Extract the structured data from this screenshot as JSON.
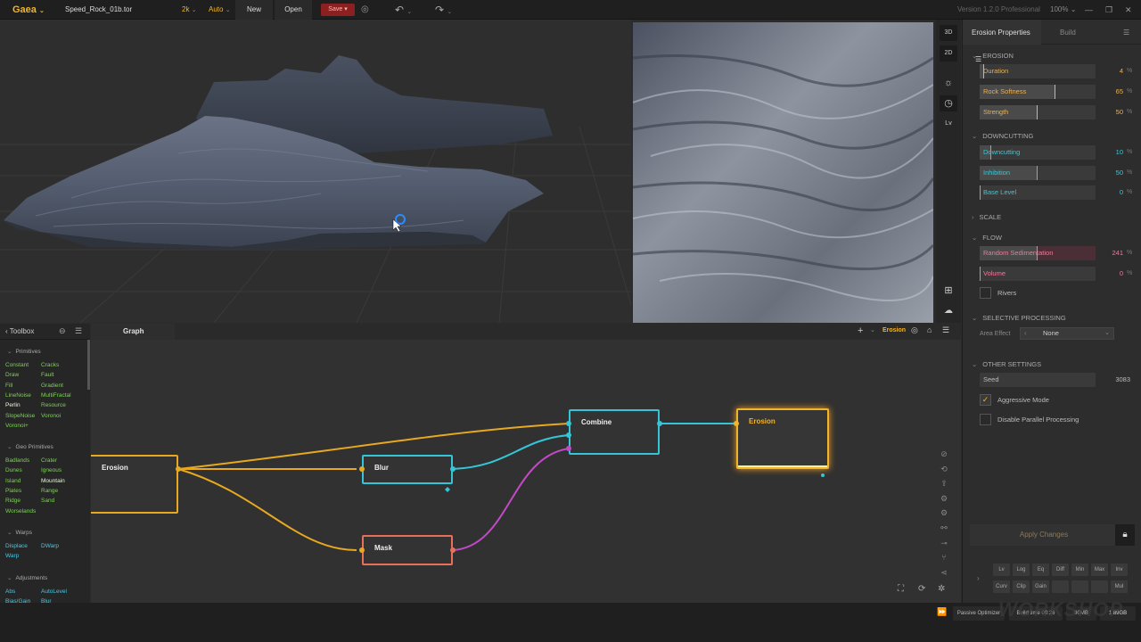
{
  "topbar": {
    "app_name": "Gaea",
    "file_name": "Speed_Rock_01b.tor",
    "resolution": "2k",
    "mode": "Auto",
    "new_label": "New",
    "open_label": "Open",
    "save_label": "Save",
    "version": "Version 1.2.0 Professional",
    "zoom": "100%"
  },
  "view_tools": {
    "btn_3d": "3D",
    "btn_2d": "2D",
    "btn_lv": "Lv"
  },
  "properties": {
    "tab_active": "Erosion Properties",
    "tab_build": "Build",
    "sections": {
      "erosion": "EROSION",
      "downcutting": "DOWNCUTTING",
      "scale": "SCALE",
      "flow": "FLOW",
      "selective": "SELECTIVE PROCESSING",
      "other": "OTHER SETTINGS"
    },
    "params": [
      {
        "label": "Duration",
        "value": "4",
        "unit": "%",
        "fill": 0.04,
        "color": "#e8b25a"
      },
      {
        "label": "Rock Softness",
        "value": "65",
        "unit": "%",
        "fill": 0.65,
        "color": "#e8b25a"
      },
      {
        "label": "Strength",
        "value": "50",
        "unit": "%",
        "fill": 0.5,
        "color": "#e8b25a"
      },
      {
        "label": "Downcutting",
        "value": "10",
        "unit": "%",
        "fill": 0.1,
        "color": "#3cc8d8"
      },
      {
        "label": "Inhibition",
        "value": "50",
        "unit": "%",
        "fill": 0.5,
        "color": "#3cc8d8"
      },
      {
        "label": "Base Level",
        "value": "0",
        "unit": "%",
        "fill": 0.0,
        "color": "#3cc8d8"
      },
      {
        "label": "Random Sedimentation",
        "value": "241",
        "unit": "%",
        "fill": 0.5,
        "color": "#f07a9a"
      },
      {
        "label": "Volume",
        "value": "0",
        "unit": "%",
        "fill": 0.0,
        "color": "#f07a9a"
      }
    ],
    "rivers_label": "Rivers",
    "area_effect_label": "Area Effect",
    "area_effect_value": "None",
    "seed_label": "Seed",
    "seed_value": "3083",
    "aggressive_label": "Aggressive Mode",
    "aggressive_checked": true,
    "parallel_label": "Disable Parallel Processing",
    "parallel_checked": false,
    "apply_label": "Apply Changes",
    "quick_row1": [
      "Lv",
      "Log",
      "Eq",
      "Diff",
      "Min",
      "Max",
      "Inv"
    ],
    "quick_row2": [
      "Curv",
      "Clip",
      "Gain",
      "",
      "",
      "",
      "Mul"
    ]
  },
  "toolbox": {
    "title": "Toolbox",
    "categories": [
      {
        "name": "Primitives",
        "items": [
          "Constant",
          "Cracks",
          "Draw",
          "Fault",
          "Fill",
          "Gradient",
          "LineNoise",
          "MultiFractal",
          "Perlin",
          "Resource",
          "SlopeNoise",
          "Voronoi",
          "Voronoi+"
        ]
      },
      {
        "name": "Geo Primitives",
        "items": [
          "Badlands",
          "Crater",
          "Dunes",
          "Igneous",
          "Island",
          "Mountain",
          "Plates",
          "Range",
          "Ridge",
          "Sand",
          "Worselands"
        ]
      },
      {
        "name": "Warps",
        "items": [
          "Displace",
          "DWarp",
          "Warp"
        ]
      },
      {
        "name": "Adjustments",
        "items": [
          "Abs",
          "AutoLevel",
          "Bias/Gain",
          "Blur"
        ]
      }
    ]
  },
  "graph": {
    "tab_label": "Graph",
    "active_node": "Erosion",
    "nodes": [
      {
        "name": "Erosion",
        "id": "erosion-src"
      },
      {
        "name": "Blur",
        "id": "blur"
      },
      {
        "name": "Mask",
        "id": "mask"
      },
      {
        "name": "Combine",
        "id": "combine"
      },
      {
        "name": "Erosion",
        "id": "erosion-out"
      }
    ]
  },
  "status": {
    "optimizer": "Passive Optimizer",
    "build_time": "Build time 00:26",
    "memory": "90MB",
    "disk": "1.89GB"
  },
  "watermark": "WORKSHOP",
  "colors": {
    "accent": "#f2b428",
    "cyan": "#3cc8d8",
    "pink": "#d050d0",
    "mask": "#e8705a"
  }
}
